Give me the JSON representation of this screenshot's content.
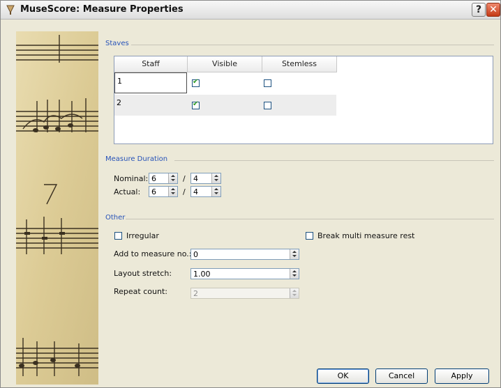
{
  "window": {
    "title": "MuseScore: Measure Properties",
    "help_label": "?",
    "close_label": "✕"
  },
  "staves": {
    "group_title": "Staves",
    "columns": [
      "Staff",
      "Visible",
      "Stemless"
    ],
    "rows": [
      {
        "staff": "1",
        "visible": true,
        "stemless": false
      },
      {
        "staff": "2",
        "visible": true,
        "stemless": false
      }
    ]
  },
  "duration": {
    "group_title": "Measure Duration",
    "nominal_label": "Nominal:",
    "actual_label": "Actual:",
    "nominal_num": "6",
    "nominal_den": "4",
    "actual_num": "6",
    "actual_den": "4",
    "separator": "/"
  },
  "other": {
    "group_title": "Other",
    "irregular_label": "Irregular",
    "irregular_checked": false,
    "break_rest_label": "Break multi measure rest",
    "break_rest_checked": false,
    "add_label": "Add to measure no.:",
    "add_value": "0",
    "stretch_label": "Layout stretch:",
    "stretch_value": "1.00",
    "repeat_label": "Repeat count:",
    "repeat_value": "2",
    "repeat_enabled": false
  },
  "buttons": {
    "ok": "OK",
    "cancel": "Cancel",
    "apply": "Apply"
  },
  "colors": {
    "group_title": "#2652b8",
    "dialog_bg": "#ece9d8",
    "close_button": "#c43a16"
  }
}
